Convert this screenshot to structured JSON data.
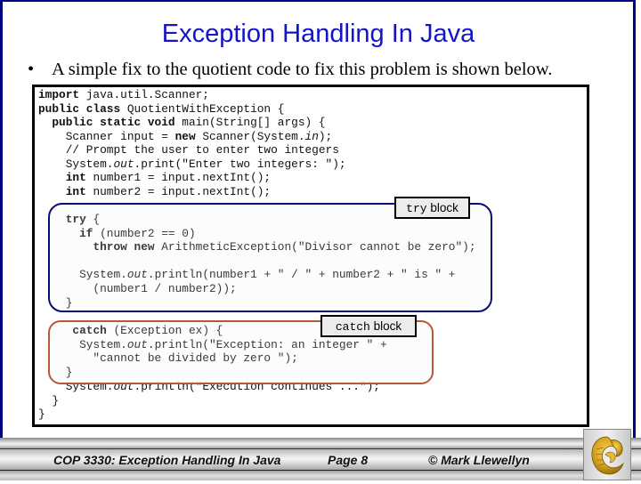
{
  "slide": {
    "title": "Exception Handling In Java",
    "bullet_symbol": "•",
    "bullet_text": "A simple fix to the quotient code to fix this problem is shown below."
  },
  "code": {
    "lines": [
      [
        {
          "t": "import",
          "s": "b"
        },
        {
          "t": " java.util.Scanner;"
        }
      ],
      [
        {
          "t": "public class",
          "s": "b"
        },
        {
          "t": " QuotientWithException {"
        }
      ],
      [
        {
          "t": "  "
        },
        {
          "t": "public static void",
          "s": "b"
        },
        {
          "t": " main(String[] args) {"
        }
      ],
      [
        {
          "t": "    Scanner input = "
        },
        {
          "t": "new",
          "s": "b"
        },
        {
          "t": " Scanner(System."
        },
        {
          "t": "in",
          "s": "i"
        },
        {
          "t": ");"
        }
      ],
      [
        {
          "t": "    // Prompt the user to enter two integers"
        }
      ],
      [
        {
          "t": "    System."
        },
        {
          "t": "out",
          "s": "i"
        },
        {
          "t": ".print(\"Enter two integers: \");"
        }
      ],
      [
        {
          "t": "    "
        },
        {
          "t": "int",
          "s": "b"
        },
        {
          "t": " number1 = input.nextInt();"
        }
      ],
      [
        {
          "t": "    "
        },
        {
          "t": "int",
          "s": "b"
        },
        {
          "t": " number2 = input.nextInt();"
        }
      ]
    ],
    "try_lines": [
      [
        {
          "t": "    "
        },
        {
          "t": "try",
          "s": "b"
        },
        {
          "t": " {"
        }
      ],
      [
        {
          "t": "      "
        },
        {
          "t": "if",
          "s": "b"
        },
        {
          "t": " (number2 == 0)"
        }
      ],
      [
        {
          "t": "        "
        },
        {
          "t": "throw new",
          "s": "b"
        },
        {
          "t": " ArithmeticException(\"Divisor cannot be zero\");"
        }
      ],
      [
        {
          "t": ""
        }
      ],
      [
        {
          "t": "      System."
        },
        {
          "t": "out",
          "s": "i"
        },
        {
          "t": ".println(number1 + \" / \" + number2 + \" is \" +"
        }
      ],
      [
        {
          "t": "        (number1 / number2));"
        }
      ],
      [
        {
          "t": "    }"
        }
      ]
    ],
    "catch_lines": [
      [
        {
          "t": "     "
        },
        {
          "t": "catch",
          "s": "b"
        },
        {
          "t": " (Exception ex) {"
        }
      ],
      [
        {
          "t": "      System."
        },
        {
          "t": "out",
          "s": "i"
        },
        {
          "t": ".println(\"Exception: an integer \" +"
        }
      ],
      [
        {
          "t": "        \"cannot be divided by zero \");"
        }
      ],
      [
        {
          "t": "    }"
        }
      ]
    ],
    "after_lines": [
      [
        {
          "t": "    System."
        },
        {
          "t": "out",
          "s": "i"
        },
        {
          "t": ".println(\"Execution continues ...\");"
        }
      ],
      [
        {
          "t": "  }"
        }
      ],
      [
        {
          "t": "}"
        }
      ]
    ]
  },
  "callouts": {
    "try_label_code": "try",
    "try_label_text": "block",
    "catch_label_code": "catch",
    "catch_label_text": "block"
  },
  "footer": {
    "course": "COP 3330:  Exception Handling In Java",
    "page": "Page 8",
    "copyright": "© Mark Llewellyn"
  },
  "colors": {
    "title": "#1414c8",
    "frame": "#000080",
    "try_outline": "#0a0a7a",
    "catch_outline": "#b8573a"
  }
}
